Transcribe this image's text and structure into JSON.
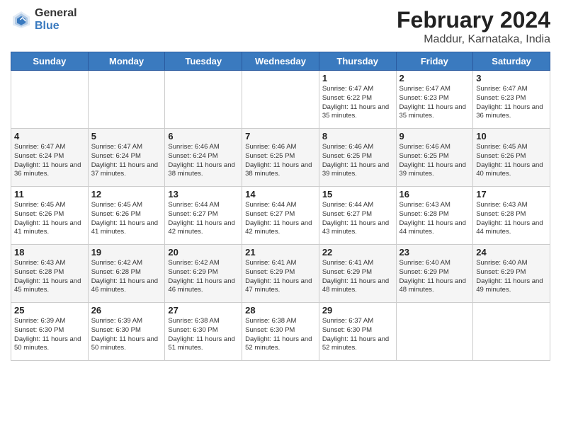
{
  "header": {
    "logo_general": "General",
    "logo_blue": "Blue",
    "month_title": "February 2024",
    "location": "Maddur, Karnataka, India"
  },
  "days_of_week": [
    "Sunday",
    "Monday",
    "Tuesday",
    "Wednesday",
    "Thursday",
    "Friday",
    "Saturday"
  ],
  "weeks": [
    [
      {
        "day": "",
        "info": ""
      },
      {
        "day": "",
        "info": ""
      },
      {
        "day": "",
        "info": ""
      },
      {
        "day": "",
        "info": ""
      },
      {
        "day": "1",
        "info": "Sunrise: 6:47 AM\nSunset: 6:22 PM\nDaylight: 11 hours\nand 35 minutes."
      },
      {
        "day": "2",
        "info": "Sunrise: 6:47 AM\nSunset: 6:23 PM\nDaylight: 11 hours\nand 35 minutes."
      },
      {
        "day": "3",
        "info": "Sunrise: 6:47 AM\nSunset: 6:23 PM\nDaylight: 11 hours\nand 36 minutes."
      }
    ],
    [
      {
        "day": "4",
        "info": "Sunrise: 6:47 AM\nSunset: 6:24 PM\nDaylight: 11 hours\nand 36 minutes."
      },
      {
        "day": "5",
        "info": "Sunrise: 6:47 AM\nSunset: 6:24 PM\nDaylight: 11 hours\nand 37 minutes."
      },
      {
        "day": "6",
        "info": "Sunrise: 6:46 AM\nSunset: 6:24 PM\nDaylight: 11 hours\nand 38 minutes."
      },
      {
        "day": "7",
        "info": "Sunrise: 6:46 AM\nSunset: 6:25 PM\nDaylight: 11 hours\nand 38 minutes."
      },
      {
        "day": "8",
        "info": "Sunrise: 6:46 AM\nSunset: 6:25 PM\nDaylight: 11 hours\nand 39 minutes."
      },
      {
        "day": "9",
        "info": "Sunrise: 6:46 AM\nSunset: 6:25 PM\nDaylight: 11 hours\nand 39 minutes."
      },
      {
        "day": "10",
        "info": "Sunrise: 6:45 AM\nSunset: 6:26 PM\nDaylight: 11 hours\nand 40 minutes."
      }
    ],
    [
      {
        "day": "11",
        "info": "Sunrise: 6:45 AM\nSunset: 6:26 PM\nDaylight: 11 hours\nand 41 minutes."
      },
      {
        "day": "12",
        "info": "Sunrise: 6:45 AM\nSunset: 6:26 PM\nDaylight: 11 hours\nand 41 minutes."
      },
      {
        "day": "13",
        "info": "Sunrise: 6:44 AM\nSunset: 6:27 PM\nDaylight: 11 hours\nand 42 minutes."
      },
      {
        "day": "14",
        "info": "Sunrise: 6:44 AM\nSunset: 6:27 PM\nDaylight: 11 hours\nand 42 minutes."
      },
      {
        "day": "15",
        "info": "Sunrise: 6:44 AM\nSunset: 6:27 PM\nDaylight: 11 hours\nand 43 minutes."
      },
      {
        "day": "16",
        "info": "Sunrise: 6:43 AM\nSunset: 6:28 PM\nDaylight: 11 hours\nand 44 minutes."
      },
      {
        "day": "17",
        "info": "Sunrise: 6:43 AM\nSunset: 6:28 PM\nDaylight: 11 hours\nand 44 minutes."
      }
    ],
    [
      {
        "day": "18",
        "info": "Sunrise: 6:43 AM\nSunset: 6:28 PM\nDaylight: 11 hours\nand 45 minutes."
      },
      {
        "day": "19",
        "info": "Sunrise: 6:42 AM\nSunset: 6:28 PM\nDaylight: 11 hours\nand 46 minutes."
      },
      {
        "day": "20",
        "info": "Sunrise: 6:42 AM\nSunset: 6:29 PM\nDaylight: 11 hours\nand 46 minutes."
      },
      {
        "day": "21",
        "info": "Sunrise: 6:41 AM\nSunset: 6:29 PM\nDaylight: 11 hours\nand 47 minutes."
      },
      {
        "day": "22",
        "info": "Sunrise: 6:41 AM\nSunset: 6:29 PM\nDaylight: 11 hours\nand 48 minutes."
      },
      {
        "day": "23",
        "info": "Sunrise: 6:40 AM\nSunset: 6:29 PM\nDaylight: 11 hours\nand 48 minutes."
      },
      {
        "day": "24",
        "info": "Sunrise: 6:40 AM\nSunset: 6:29 PM\nDaylight: 11 hours\nand 49 minutes."
      }
    ],
    [
      {
        "day": "25",
        "info": "Sunrise: 6:39 AM\nSunset: 6:30 PM\nDaylight: 11 hours\nand 50 minutes."
      },
      {
        "day": "26",
        "info": "Sunrise: 6:39 AM\nSunset: 6:30 PM\nDaylight: 11 hours\nand 50 minutes."
      },
      {
        "day": "27",
        "info": "Sunrise: 6:38 AM\nSunset: 6:30 PM\nDaylight: 11 hours\nand 51 minutes."
      },
      {
        "day": "28",
        "info": "Sunrise: 6:38 AM\nSunset: 6:30 PM\nDaylight: 11 hours\nand 52 minutes."
      },
      {
        "day": "29",
        "info": "Sunrise: 6:37 AM\nSunset: 6:30 PM\nDaylight: 11 hours\nand 52 minutes."
      },
      {
        "day": "",
        "info": ""
      },
      {
        "day": "",
        "info": ""
      }
    ]
  ],
  "accent_color": "#3a7abf"
}
